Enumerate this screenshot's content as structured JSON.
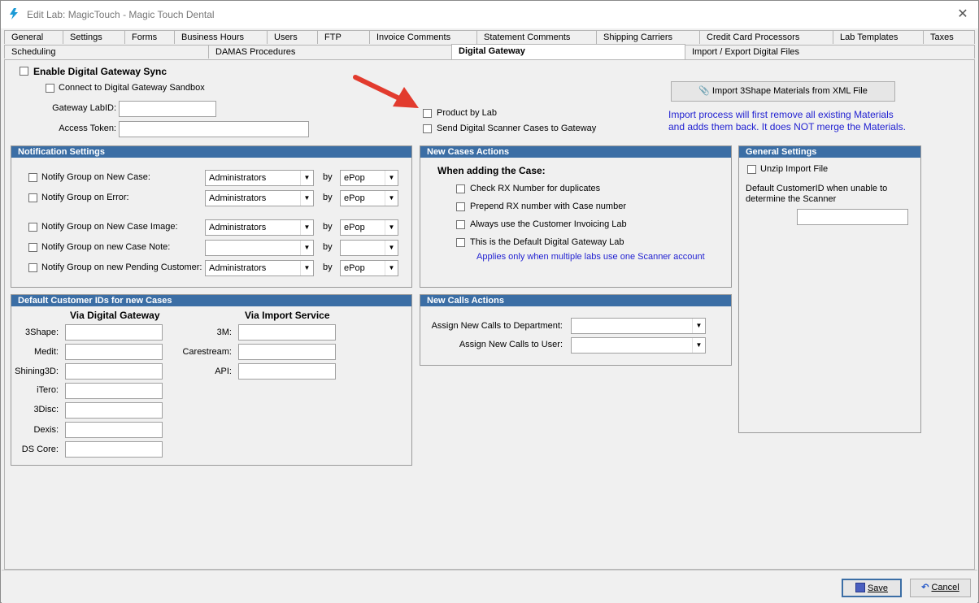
{
  "window": {
    "title": "Edit Lab: MagicTouch - Magic Touch Dental",
    "close_glyph": "✕"
  },
  "tabs_row1": [
    {
      "label": "General"
    },
    {
      "label": "Settings"
    },
    {
      "label": "Forms"
    },
    {
      "label": "Business Hours"
    },
    {
      "label": "Users"
    },
    {
      "label": "FTP"
    },
    {
      "label": "Invoice Comments"
    },
    {
      "label": "Statement Comments"
    },
    {
      "label": "Shipping Carriers"
    },
    {
      "label": "Credit Card Processors"
    },
    {
      "label": "Lab Templates"
    },
    {
      "label": "Taxes"
    }
  ],
  "tabs_row2": [
    {
      "label": "Scheduling"
    },
    {
      "label": "DAMAS Procedures"
    },
    {
      "label": "Digital Gateway"
    },
    {
      "label": "Import / Export Digital Files"
    }
  ],
  "top": {
    "enable_sync": "Enable Digital Gateway Sync",
    "sandbox": "Connect to Digital Gateway Sandbox",
    "labid_label": "Gateway LabID:",
    "token_label": "Access Token:",
    "product_by_lab": "Product by Lab",
    "send_scanner": "Send Digital Scanner Cases to Gateway",
    "import_button": "Import 3Shape Materials from XML File",
    "import_note_1": "Import process will first remove all existing Materials",
    "import_note_2": "and adds them back. It does NOT merge the Materials.",
    "annotation_color": "#e23b2e"
  },
  "notification": {
    "header": "Notification Settings",
    "by": "by",
    "rows": [
      {
        "label": "Notify Group on New Case:",
        "group": "Administrators",
        "via": "ePop"
      },
      {
        "label": "Notify Group on Error:",
        "group": "Administrators",
        "via": "ePop"
      },
      {
        "label": "Notify Group on New Case Image:",
        "group": "Administrators",
        "via": "ePop"
      },
      {
        "label": "Notify Group on new Case Note:",
        "group": "",
        "via": ""
      },
      {
        "label": "Notify Group on new Pending Customer:",
        "group": "Administrators",
        "via": "ePop"
      }
    ]
  },
  "new_cases": {
    "header": "New Cases Actions",
    "subtitle": "When adding the Case:",
    "opt1": "Check RX Number for duplicates",
    "opt2": "Prepend RX number with Case number",
    "opt3": "Always use the Customer Invoicing Lab",
    "opt4": "This is the Default Digital Gateway Lab",
    "note": "Applies only when multiple labs use one Scanner account"
  },
  "general": {
    "header": "General Settings",
    "unzip": "Unzip Import File",
    "default_cust_1": "Default CustomerID when unable to",
    "default_cust_2": "determine the Scanner"
  },
  "defaults": {
    "header": "Default Customer IDs for new Cases",
    "col1_title": "Via Digital Gateway",
    "col2_title": "Via Import Service",
    "col1": [
      "3Shape:",
      "Medit:",
      "Shining3D:",
      "iTero:",
      "3Disc:",
      "Dexis:",
      "DS Core:"
    ],
    "col2": [
      "3M:",
      "Carestream:",
      "API:"
    ]
  },
  "calls": {
    "header": "New Calls Actions",
    "dept": "Assign New Calls to Department:",
    "user": "Assign New Calls to User:"
  },
  "footer": {
    "save": "Save",
    "cancel": "Cancel"
  },
  "colors": {
    "group_header": "#3b6ea5",
    "note_blue": "#1f1fd1"
  }
}
